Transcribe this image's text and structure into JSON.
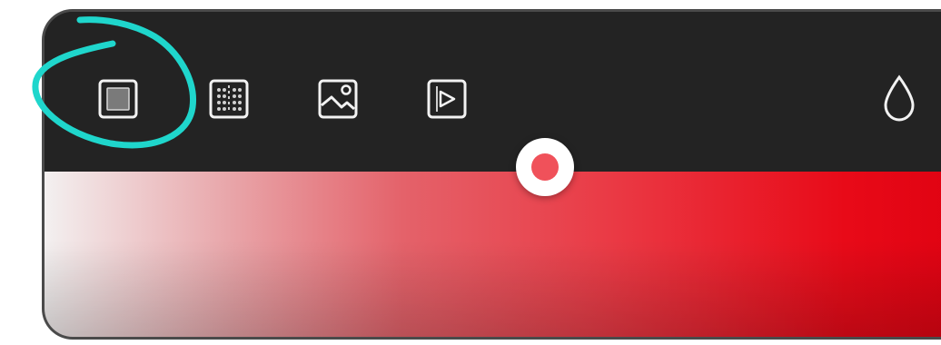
{
  "toolbar": {
    "tools": [
      {
        "id": "solid",
        "icon": "solid-fill-icon",
        "selected": true
      },
      {
        "id": "pattern",
        "icon": "pattern-fill-icon",
        "selected": false
      },
      {
        "id": "image",
        "icon": "image-fill-icon",
        "selected": false
      },
      {
        "id": "video",
        "icon": "video-fill-icon",
        "selected": false
      }
    ],
    "opacity_icon": "opacity-drop-icon"
  },
  "color_field": {
    "selected_color": "#f0515a",
    "hue_color": "#e80a18"
  },
  "annotation": {
    "color": "#1fd6cc"
  }
}
